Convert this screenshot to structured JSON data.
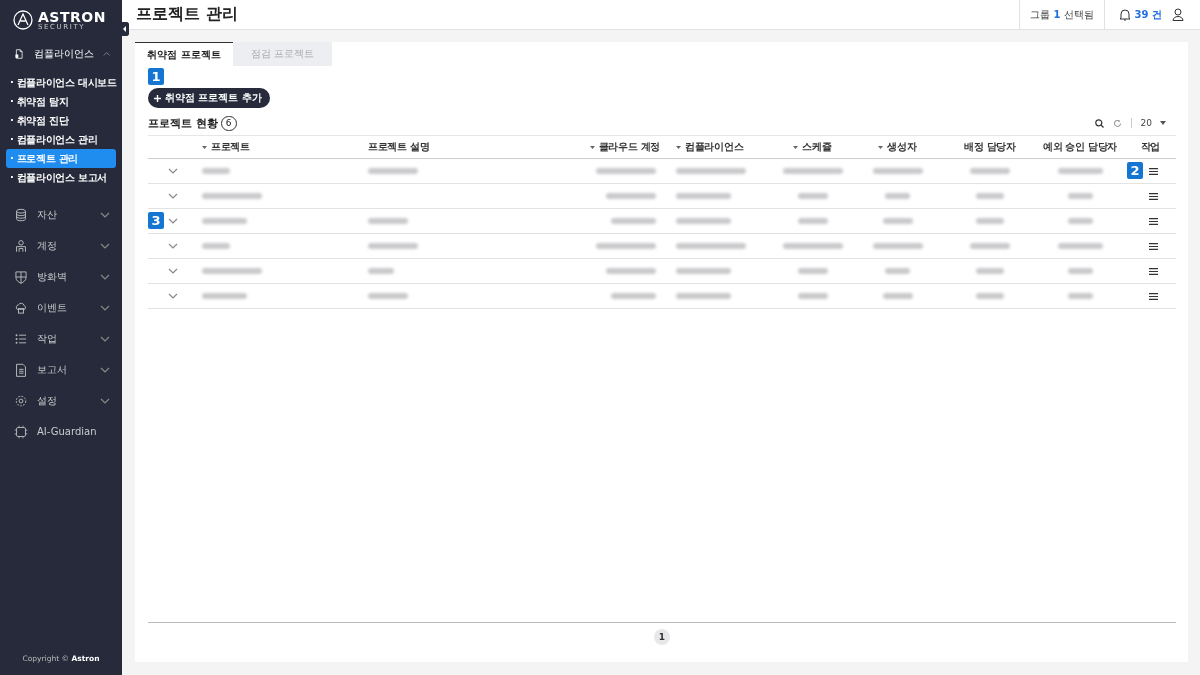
{
  "sidebar": {
    "logo": {
      "name": "ASTRON",
      "tagline": "SECURITY"
    },
    "menu": [
      {
        "label": "컴플라이언스",
        "kind": "group",
        "expanded": true,
        "children": [
          {
            "label": "· 컴플라이언스 대시보드",
            "selected": false
          },
          {
            "label": "· 취약점 탐지",
            "selected": false
          },
          {
            "label": "· 취약점 진단",
            "selected": false
          },
          {
            "label": "· 컴플라이언스 관리",
            "selected": false
          },
          {
            "label": "· 프로젝트 관리",
            "selected": true
          },
          {
            "label": "· 컴플라이언스 보고서",
            "selected": false
          }
        ]
      },
      {
        "label": "자산",
        "kind": "group",
        "expanded": false
      },
      {
        "label": "계정",
        "kind": "group",
        "expanded": false
      },
      {
        "label": "방화벽",
        "kind": "group",
        "expanded": false
      },
      {
        "label": "이벤트",
        "kind": "group",
        "expanded": false
      },
      {
        "label": "작업",
        "kind": "group",
        "expanded": false
      },
      {
        "label": "보고서",
        "kind": "group",
        "expanded": false
      },
      {
        "label": "설정",
        "kind": "group",
        "expanded": false
      },
      {
        "label": "AI-Guardian",
        "kind": "link"
      }
    ],
    "copyright": "Copyright © **Astron**"
  },
  "header": {
    "title": "프로젝트 관리",
    "group_selection": "그룹 **1** 선택됨",
    "notifications": "39 건"
  },
  "tabs": [
    {
      "label": "취약점 프로젝트",
      "selected": true
    },
    {
      "label": "점검 프로젝트",
      "selected": false
    }
  ],
  "add_button": {
    "label": "취약점 프로젝트 추가",
    "callout": "1"
  },
  "section": {
    "title": "프로젝트 현황",
    "count": "6"
  },
  "toolbar": {
    "page_size": "20"
  },
  "table": {
    "columns": [
      {
        "label": "프로젝트",
        "sortable": true
      },
      {
        "label": "프로젝트 설명",
        "sortable": false
      },
      {
        "label": "클라우드 계정",
        "sortable": true
      },
      {
        "label": "컴플라이언스",
        "sortable": true
      },
      {
        "label": "스케쥴",
        "sortable": true
      },
      {
        "label": "생성자",
        "sortable": true
      },
      {
        "label": "배정 담당자",
        "sortable": false
      },
      {
        "label": "예외 승인 담당자",
        "sortable": false
      },
      {
        "label": "작업",
        "sortable": false
      }
    ],
    "rows": [
      {
        "expanded": false,
        "blurred": [
          true,
          true,
          true,
          true,
          true,
          true,
          true,
          true
        ],
        "action_callout": "2"
      },
      {
        "expanded": false,
        "blurred": [
          true,
          false,
          true,
          true,
          true,
          true,
          true,
          true
        ]
      },
      {
        "expanded": false,
        "blurred": [
          true,
          true,
          true,
          true,
          true,
          true,
          true,
          true
        ],
        "expand_callout": "3"
      },
      {
        "expanded": false,
        "blurred": [
          true,
          true,
          true,
          true,
          true,
          true,
          true,
          true
        ]
      },
      {
        "expanded": false,
        "blurred": [
          true,
          true,
          true,
          true,
          true,
          true,
          true,
          true
        ]
      },
      {
        "expanded": false,
        "blurred": [
          true,
          true,
          true,
          true,
          true,
          true,
          true,
          true
        ]
      }
    ]
  },
  "pagination": {
    "pages": [
      {
        "label": "1",
        "selected": true
      }
    ]
  }
}
